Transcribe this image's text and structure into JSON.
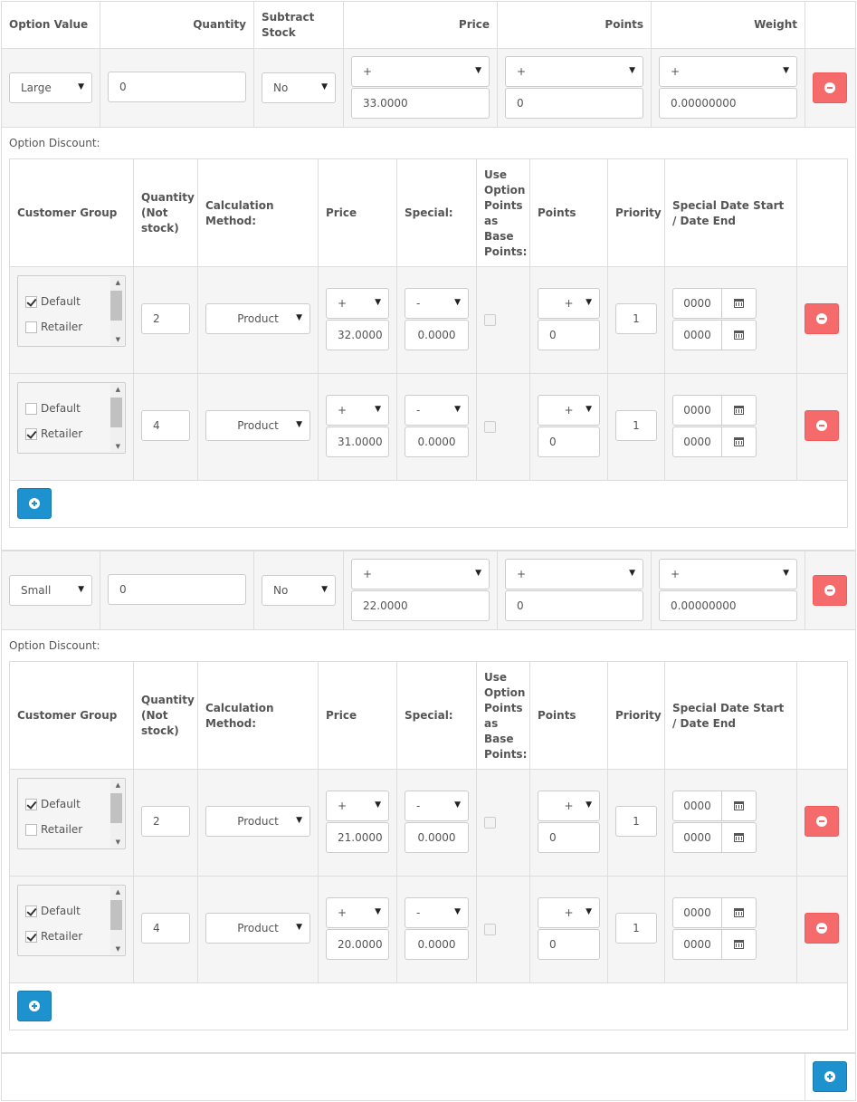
{
  "headers": {
    "option_value": "Option Value",
    "quantity": "Quantity",
    "subtract_stock": "Subtract Stock",
    "price": "Price",
    "points": "Points",
    "weight": "Weight"
  },
  "discount_label": "Option Discount:",
  "discount_headers": {
    "customer_group": "Customer Group",
    "quantity": "Quantity (Not stock)",
    "calculation_method": "Calculation Method:",
    "price": "Price",
    "special": "Special:",
    "use_points": "Use Option Points as Base Points:",
    "points": "Points",
    "priority": "Priority",
    "special_date": "Special Date Start / Date End"
  },
  "customer_groups": [
    "Default",
    "Retailer"
  ],
  "options": [
    {
      "value": "Large",
      "quantity": "0",
      "subtract": "No",
      "price_prefix": "+",
      "price": "33.0000",
      "points_prefix": "+",
      "points": "0",
      "weight_prefix": "+",
      "weight": "0.00000000",
      "discounts": [
        {
          "default_checked": true,
          "retailer_checked": false,
          "quantity": "2",
          "method": "Product",
          "price_prefix": "+",
          "price": "32.0000",
          "special_prefix": "-",
          "special": "0.0000",
          "points_prefix": "+",
          "points": "0",
          "priority": "1",
          "date_start": "0000",
          "date_end": "0000"
        },
        {
          "default_checked": false,
          "retailer_checked": true,
          "quantity": "4",
          "method": "Product",
          "price_prefix": "+",
          "price": "31.0000",
          "special_prefix": "-",
          "special": "0.0000",
          "points_prefix": "+",
          "points": "0",
          "priority": "1",
          "date_start": "0000",
          "date_end": "0000"
        }
      ]
    },
    {
      "value": "Small",
      "quantity": "0",
      "subtract": "No",
      "price_prefix": "+",
      "price": "22.0000",
      "points_prefix": "+",
      "points": "0",
      "weight_prefix": "+",
      "weight": "0.00000000",
      "discounts": [
        {
          "default_checked": true,
          "retailer_checked": false,
          "quantity": "2",
          "method": "Product",
          "price_prefix": "+",
          "price": "21.0000",
          "special_prefix": "-",
          "special": "0.0000",
          "points_prefix": "+",
          "points": "0",
          "priority": "1",
          "date_start": "0000",
          "date_end": "0000"
        },
        {
          "default_checked": true,
          "retailer_checked": true,
          "quantity": "4",
          "method": "Product",
          "price_prefix": "+",
          "price": "20.0000",
          "special_prefix": "-",
          "special": "0.0000",
          "points_prefix": "+",
          "points": "0",
          "priority": "1",
          "date_start": "0000",
          "date_end": "0000"
        }
      ]
    }
  ],
  "icons": {
    "remove": "minus-circle-icon",
    "add": "plus-circle-icon",
    "calendar": "calendar-icon",
    "dropdown": "caret-down-icon"
  },
  "colors": {
    "remove_button": "#f56b6b",
    "add_button": "#1e91cf",
    "border": "#dddddd",
    "row_bg": "#f5f5f5"
  }
}
